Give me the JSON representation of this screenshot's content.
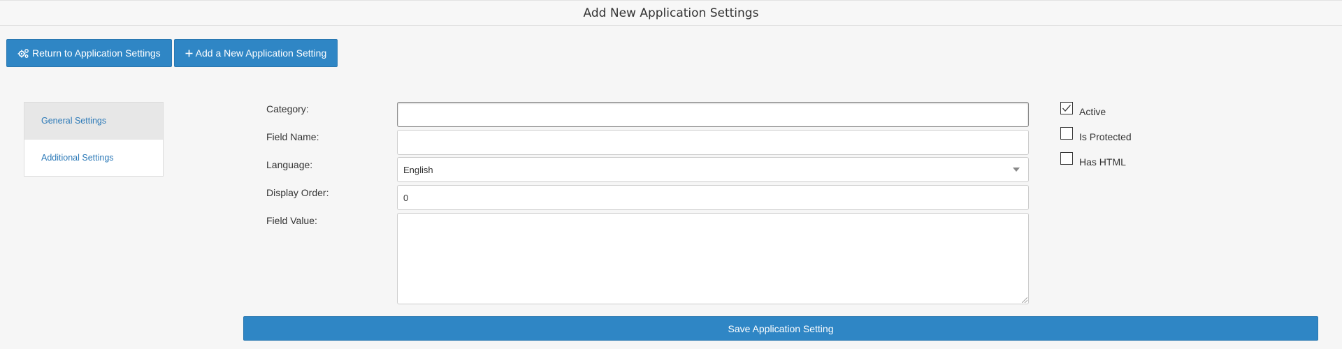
{
  "page": {
    "title": "Add New Application Settings"
  },
  "toolbar": {
    "return_label": "Return to Application Settings",
    "return_icon": "gears-icon",
    "add_label": "Add a New Application Setting",
    "add_icon": "plus-icon"
  },
  "sidebar": {
    "items": [
      {
        "label": "General Settings",
        "active": true
      },
      {
        "label": "Additional Settings",
        "active": false
      }
    ]
  },
  "form": {
    "category": {
      "label": "Category:",
      "value": "",
      "placeholder": ""
    },
    "field_name": {
      "label": "Field Name:",
      "value": "",
      "placeholder": ""
    },
    "language": {
      "label": "Language:",
      "value": "English"
    },
    "display_order": {
      "label": "Display Order:",
      "value": "0"
    },
    "field_value": {
      "label": "Field Value:",
      "value": ""
    }
  },
  "checkboxes": {
    "active": {
      "label": "Active",
      "checked": true
    },
    "is_protected": {
      "label": "Is Protected",
      "checked": false
    },
    "has_html": {
      "label": "Has HTML",
      "checked": false
    }
  },
  "actions": {
    "save_label": "Save Application Setting"
  },
  "colors": {
    "primary": "#2f86c5",
    "link": "#2a78b7"
  }
}
